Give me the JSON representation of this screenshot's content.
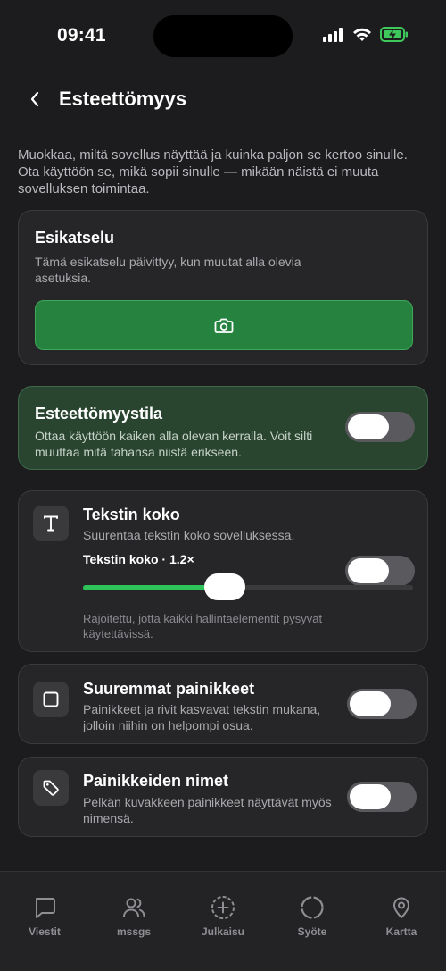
{
  "status": {
    "time": "09:41"
  },
  "header": {
    "title": "Esteettömyys"
  },
  "intro": "Muokkaa, miltä sovellus näyttää ja kuinka paljon se kertoo sinulle. Ota käyttöön se, mikä sopii sinulle — mikään näistä ei muuta sovelluksen toimintaa.",
  "preview": {
    "title": "Esikatselu",
    "description": "Tämä esikatselu päivittyy, kun muutat alla olevia asetuksia.",
    "button_icon": "camera-icon"
  },
  "mode": {
    "title": "Esteettömyystila",
    "description": "Ottaa käyttöön kaiken alla olevan kerralla. Voit silti muuttaa mitä tahansa niistä erikseen.",
    "enabled": false
  },
  "text_size": {
    "icon": "text-icon",
    "title": "Tekstin koko",
    "description": "Suurentaa tekstin koko sovelluksessa.",
    "slider_label": "Tekstin koko · 1.2×",
    "slider_fraction": 0.43,
    "enabled": false,
    "hint": "Rajoitettu, jotta kaikki hallintaelementit pysyvät käytettävissä."
  },
  "bigger_buttons": {
    "icon": "square-icon",
    "title": "Suuremmat painikkeet",
    "description": "Painikkeet ja rivit kasvavat tekstin mukana, jolloin niihin on helpompi osua.",
    "enabled": false
  },
  "button_labels": {
    "icon": "tag-icon",
    "title": "Painikkeiden nimet",
    "description": "Pelkän kuvakkeen painikkeet näyttävät myös nimensä.",
    "enabled": false
  },
  "tabs": [
    {
      "label": "Viestit",
      "icon": "message-icon"
    },
    {
      "label": "mssgs",
      "icon": "users-icon"
    },
    {
      "label": "Julkaisu",
      "icon": "plus-circle-icon"
    },
    {
      "label": "Syöte",
      "icon": "circle-icon"
    },
    {
      "label": "Kartta",
      "icon": "map-pin-icon"
    }
  ],
  "colors": {
    "accent": "#2ec35a",
    "mode_card": "#29442f",
    "preview_button": "#25823f"
  }
}
